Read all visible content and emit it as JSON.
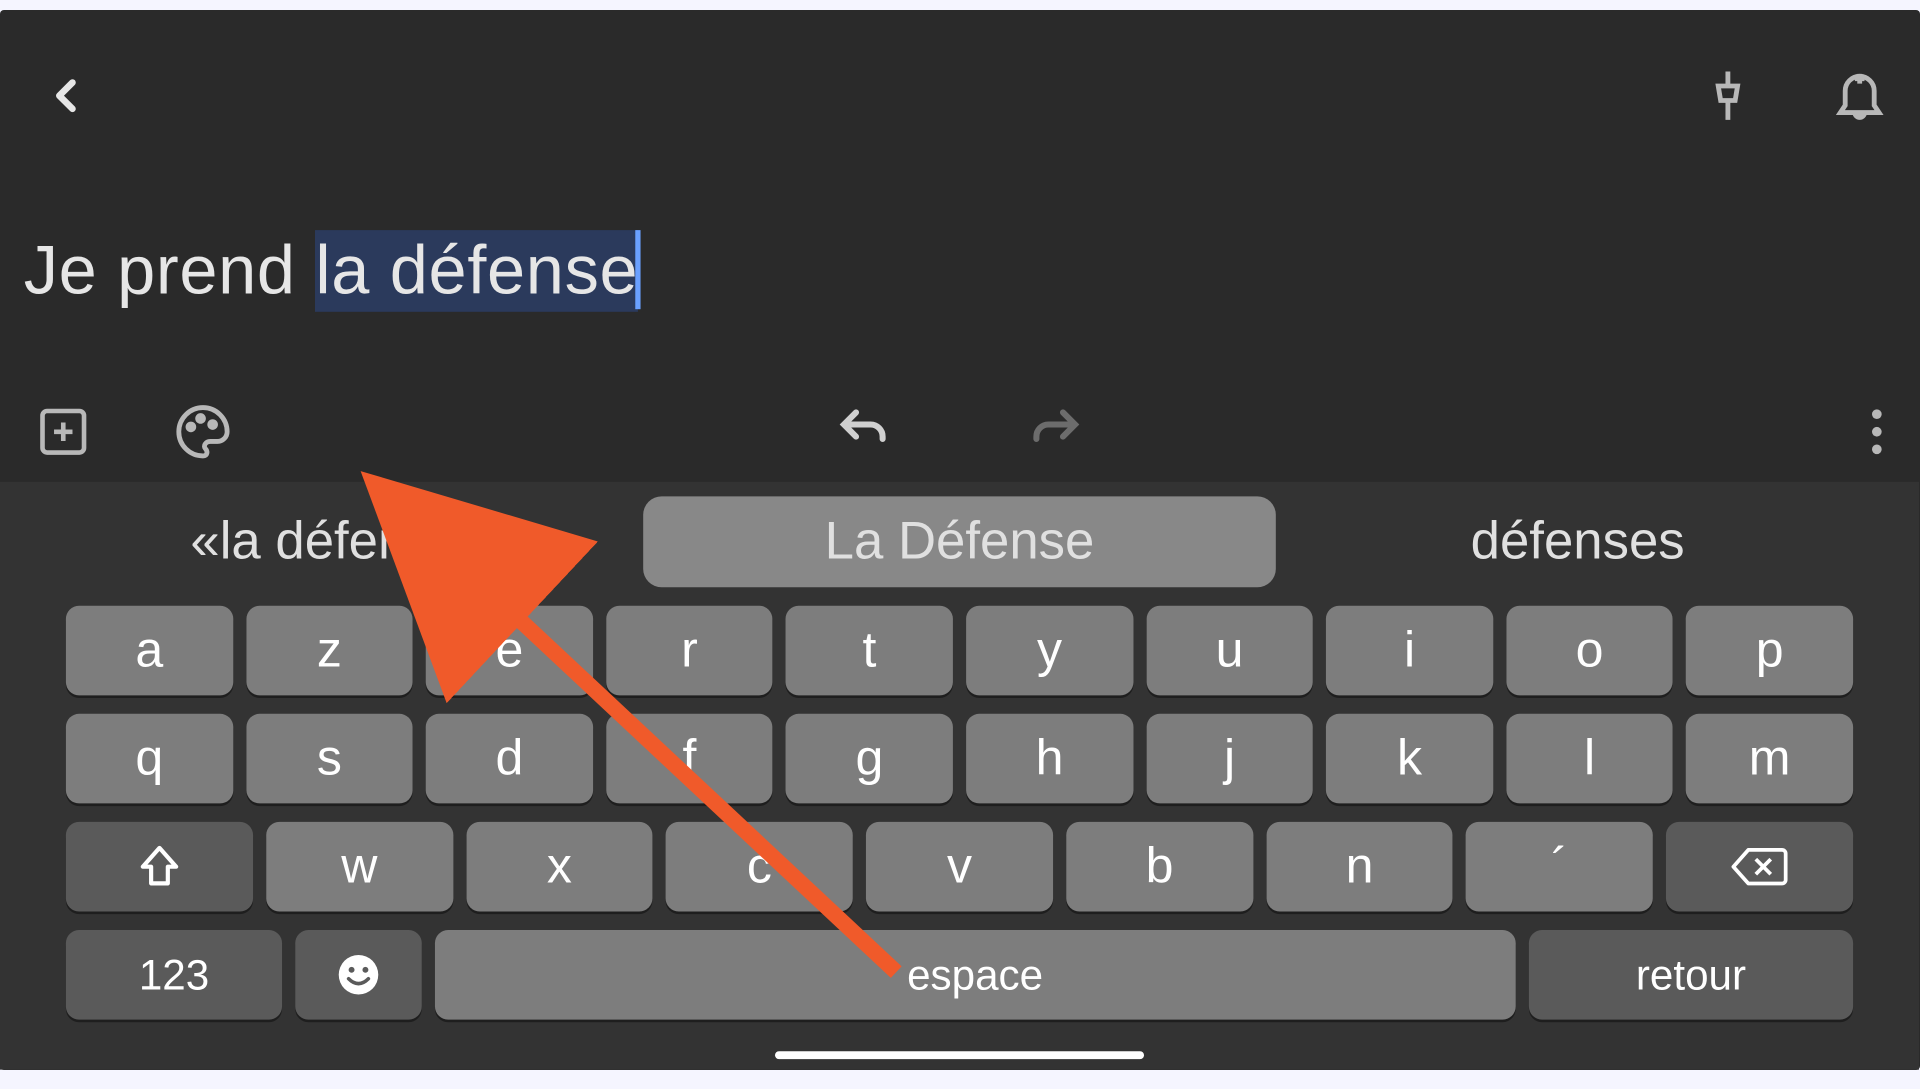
{
  "note": {
    "text_plain": "Je prend ",
    "text_selected": "la défense"
  },
  "suggestions": {
    "left": "«la défense»",
    "center": "La Défense",
    "right": "défenses"
  },
  "keyboard": {
    "row1": [
      "a",
      "z",
      "e",
      "r",
      "t",
      "y",
      "u",
      "i",
      "o",
      "p"
    ],
    "row2": [
      "q",
      "s",
      "d",
      "f",
      "g",
      "h",
      "j",
      "k",
      "l",
      "m"
    ],
    "row3": [
      "w",
      "x",
      "c",
      "v",
      "b",
      "n",
      "´"
    ],
    "numeric_label": "123",
    "space_label": "espace",
    "return_label": "retour"
  },
  "icons": {
    "back": "back-icon",
    "pin": "pin-icon",
    "bell": "bell-icon",
    "add_box": "add-box-icon",
    "palette": "palette-icon",
    "undo": "undo-icon",
    "redo": "redo-icon",
    "more": "more-icon",
    "shift": "shift-icon",
    "backspace": "backspace-icon",
    "emoji": "emoji-icon"
  },
  "annotation": {
    "arrow_color": "#f05a2a"
  }
}
